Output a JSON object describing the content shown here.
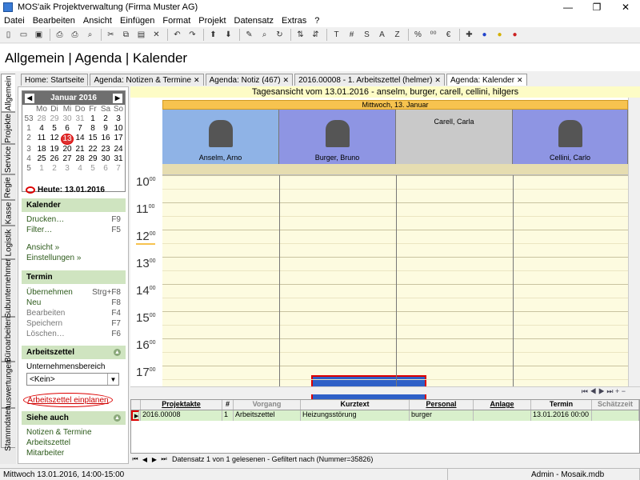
{
  "window": {
    "title": "MOS'aik Projektverwaltung (Firma Muster AG)"
  },
  "menu": [
    "Datei",
    "Bearbeiten",
    "Ansicht",
    "Einfügen",
    "Format",
    "Projekt",
    "Datensatz",
    "Extras",
    "?"
  ],
  "header": {
    "title": "Allgemein | Agenda | Kalender"
  },
  "side_tabs": [
    "Allgemein",
    "Projekte",
    "Service",
    "Regie",
    "Kasse",
    "Logistik",
    "Subunternehmer",
    "Büroarbeiten",
    "Auswertungen",
    "Stammdaten"
  ],
  "doc_tabs": [
    {
      "label": "Home: Startseite"
    },
    {
      "label": "Agenda: Notizen & Termine"
    },
    {
      "label": "Agenda: Notiz (467)"
    },
    {
      "label": "2016.00008 - 1. Arbeitszettel (helmer)"
    },
    {
      "label": "Agenda: Kalender"
    }
  ],
  "mini_calendar": {
    "month": "Januar 2016",
    "weekdays": [
      "Mo",
      "Di",
      "Mi",
      "Do",
      "Fr",
      "Sa",
      "So"
    ],
    "weeks": [
      {
        "wk": "53",
        "days": [
          "28",
          "29",
          "30",
          "31",
          "1",
          "2",
          "3"
        ]
      },
      {
        "wk": "1",
        "days": [
          "4",
          "5",
          "6",
          "7",
          "8",
          "9",
          "10"
        ]
      },
      {
        "wk": "2",
        "days": [
          "11",
          "12",
          "13",
          "14",
          "15",
          "16",
          "17"
        ]
      },
      {
        "wk": "3",
        "days": [
          "18",
          "19",
          "20",
          "21",
          "22",
          "23",
          "24"
        ]
      },
      {
        "wk": "4",
        "days": [
          "25",
          "26",
          "27",
          "28",
          "29",
          "30",
          "31"
        ]
      },
      {
        "wk": "5",
        "days": [
          "1",
          "2",
          "3",
          "4",
          "5",
          "6",
          "7"
        ]
      }
    ],
    "today_label": "Heute: 13.01.2016"
  },
  "sections": {
    "kalender": {
      "title": "Kalender",
      "items": [
        {
          "label": "Drucken…",
          "key": "F9"
        },
        {
          "label": "Filter…",
          "key": "F5"
        },
        {
          "label": "Ansicht »",
          "key": ""
        },
        {
          "label": "Einstellungen »",
          "key": ""
        }
      ]
    },
    "termin": {
      "title": "Termin",
      "items": [
        {
          "label": "Übernehmen",
          "key": "Strg+F8"
        },
        {
          "label": "Neu",
          "key": "F8"
        },
        {
          "label": "Bearbeiten",
          "key": "F4"
        },
        {
          "label": "Speichern",
          "key": "F7"
        },
        {
          "label": "Löschen…",
          "key": "F6"
        }
      ]
    },
    "arbeitszettel": {
      "title": "Arbeitszettel",
      "field_label": "Unternehmensbereich",
      "combo_value": "<Kein>",
      "link": "Arbeitszettel einplanen"
    },
    "siehe_auch": {
      "title": "Siehe auch",
      "items": [
        "Notizen & Termine",
        "Arbeitszettel",
        "Mitarbeiter"
      ]
    }
  },
  "calendar_view": {
    "title": "Tagesansicht vom 13.01.2016 - anselm, burger, carell, cellini, hilgers",
    "day_label": "Mittwoch, 13. Januar",
    "resources": [
      "Anselm, Arno",
      "Burger, Bruno",
      "Carell, Carla",
      "Cellini, Carlo"
    ],
    "hours": [
      "10",
      "11",
      "12",
      "13",
      "14",
      "15",
      "16",
      "17"
    ],
    "minutes_label": "00"
  },
  "table": {
    "columns": [
      "Projektakte",
      "#",
      "Vorgang",
      "Kurztext",
      "Personal",
      "Anlage",
      "Termin",
      "Schätzzeit"
    ],
    "rows": [
      [
        "2016.00008",
        "1",
        "Arbeitszettel",
        "Heizungsstörung",
        "burger",
        "",
        "13.01.2016 00:00",
        ""
      ]
    ]
  },
  "record_nav": {
    "text": "Datensatz 1 von 1 gelesenen - Gefiltert nach (Nummer=35826)"
  },
  "status": {
    "datetime": "Mittwoch 13.01.2016, 14:00-15:00",
    "user": "Admin - Mosaik.mdb"
  },
  "colors": {
    "section_green": "#cfe4c0",
    "day_bar": "#f7c34f",
    "appointment": "#2e5fc7",
    "highlight_red": "#dd0000"
  }
}
